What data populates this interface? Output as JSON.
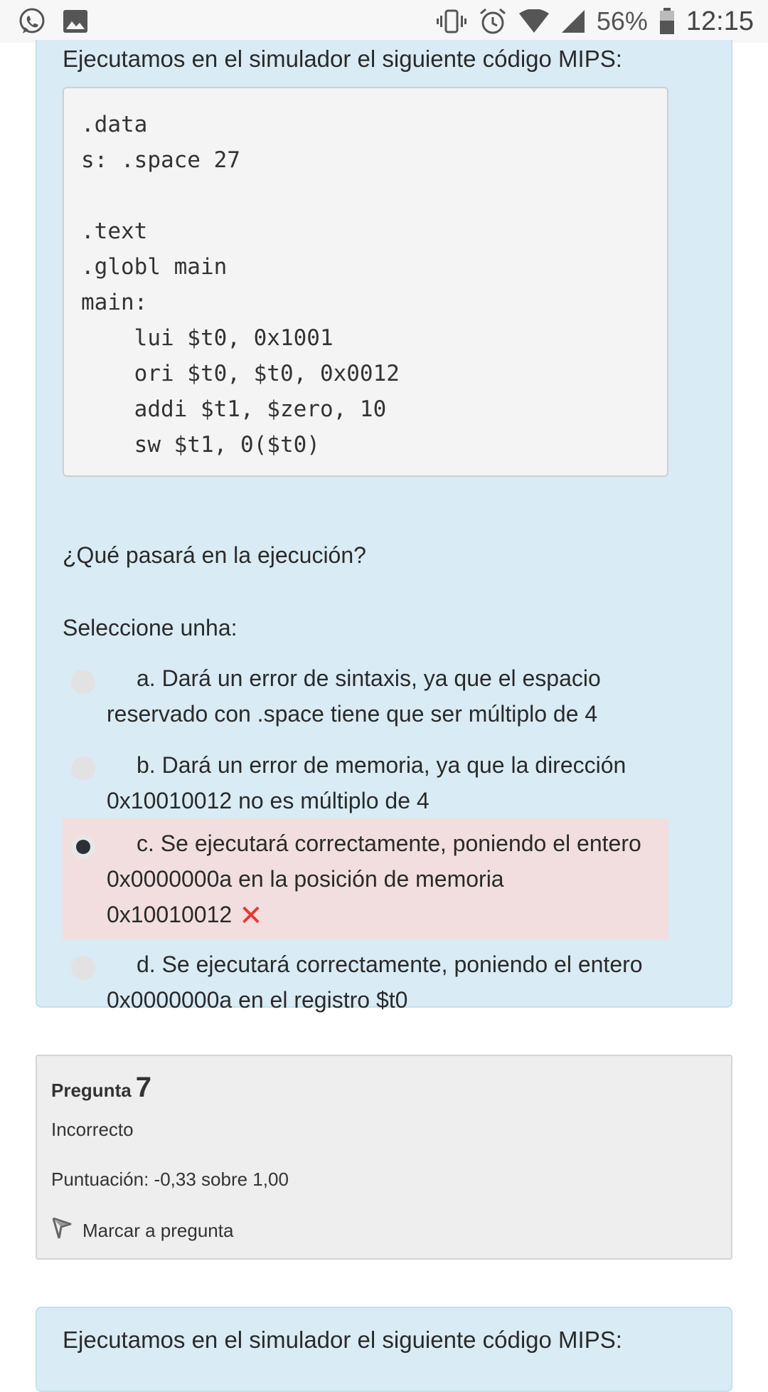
{
  "status_bar": {
    "left_icons": [
      "whatsapp-icon",
      "image-icon"
    ],
    "right_icons": [
      "vibrate-icon",
      "alarm-icon",
      "wifi-icon",
      "signal-icon",
      "battery-icon"
    ],
    "battery": "56%",
    "time": "12:15"
  },
  "question": {
    "intro": "Ejecutamos en el simulador el siguiente código MIPS:",
    "code": [
      ".data",
      "s: .space 27",
      "",
      ".text",
      ".globl main",
      "main:",
      "    lui $t0, 0x1001",
      "    ori $t0, $t0, 0x0012",
      "    addi $t1, $zero, 10",
      "    sw $t1, 0($t0)"
    ],
    "prompt": "¿Qué pasará en la ejecución?",
    "select_label": "Seleccione unha:",
    "options": [
      {
        "text": "a. Dará un error de sintaxis, ya que el espacio reservado con .space tiene que ser múltiplo de 4",
        "selected": false
      },
      {
        "text": "b. Dará un error de memoria, ya que la dirección 0x10010012 no es múltiplo de 4",
        "selected": false
      },
      {
        "text": "c. Se ejecutará correctamente, poniendo el entero 0x0000000a en la posición de memoria 0x10010012",
        "selected": true,
        "mark": "✕"
      },
      {
        "text": "d. Se ejecutará correctamente, poniendo el entero 0x0000000a en el registro $t0",
        "selected": false
      }
    ]
  },
  "info": {
    "pregunta_label": "Pregunta",
    "pregunta_number": "7",
    "state": "Incorrecto",
    "grade": "Puntuación: -0,33 sobre 1,00",
    "flag_label": "Marcar a pregunta"
  },
  "next_question": {
    "intro": "Ejecutamos en el simulador el siguiente código MIPS:"
  },
  "colors": {
    "card_bg": "#d9ebf5",
    "selected_bg": "#f2dede",
    "wrong_mark": "#e53935",
    "info_bg": "#eeeeee"
  }
}
